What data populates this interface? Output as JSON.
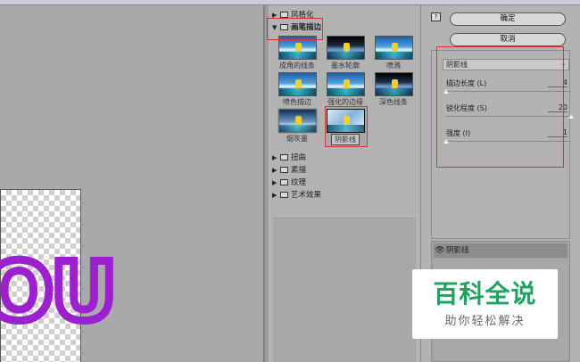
{
  "canvas": {
    "text": "OU",
    "text_color": "#9c1fd0"
  },
  "gallery": {
    "categories_top": [
      {
        "label": "风格化",
        "expanded": false
      },
      {
        "label": "画笔描边",
        "expanded": true
      }
    ],
    "thumbnails": [
      {
        "label": "成角的线条"
      },
      {
        "label": "墨水轮廓"
      },
      {
        "label": "喷溅"
      },
      {
        "label": "喷色描边"
      },
      {
        "label": "强化的边缘"
      },
      {
        "label": "深色线条"
      },
      {
        "label": "烟灰墨"
      },
      {
        "label": "阴影线"
      }
    ],
    "selected_thumbnail": "阴影线",
    "categories_bottom": [
      {
        "label": "扭曲"
      },
      {
        "label": "素描"
      },
      {
        "label": "纹理"
      },
      {
        "label": "艺术效果"
      }
    ]
  },
  "right": {
    "help_icon": "?",
    "ok_label": "确定",
    "cancel_label": "取消",
    "filter_select": "阴影线",
    "params": [
      {
        "label": "描边长度 (L)",
        "value": "4",
        "fraction": 0.0
      },
      {
        "label": "锐化程度 (S)",
        "value": "20",
        "fraction": 1.0
      },
      {
        "label": "强度 (I)",
        "value": "1",
        "fraction": 0.0
      }
    ],
    "layer": {
      "name": "阴影线",
      "visible": true
    }
  },
  "watermark": {
    "title": "百科全说",
    "subtitle": "助你轻松解决",
    "color": "#1fa463"
  },
  "colors": {
    "highlight_red": "#e23030",
    "panel_bg": "#b3b3b3"
  }
}
